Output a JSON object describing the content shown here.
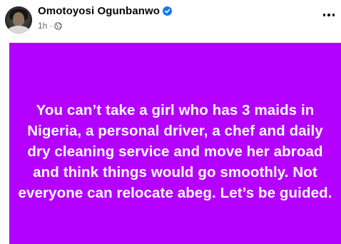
{
  "post": {
    "author": {
      "name": "Omotoyosi Ogunbanwo",
      "verified": true
    },
    "timestamp": "1h",
    "separator": "·",
    "audience_icon": "globe-icon",
    "more_icon": "more-options-icon",
    "background_color": "#b400ff",
    "text": "You can’t take a girl who has 3 maids in Nigeria, a personal driver, a chef and daily dry cleaning service and move her abroad and think things would go smoothly. Not everyone can relocate abeg. Let’s be guided."
  }
}
